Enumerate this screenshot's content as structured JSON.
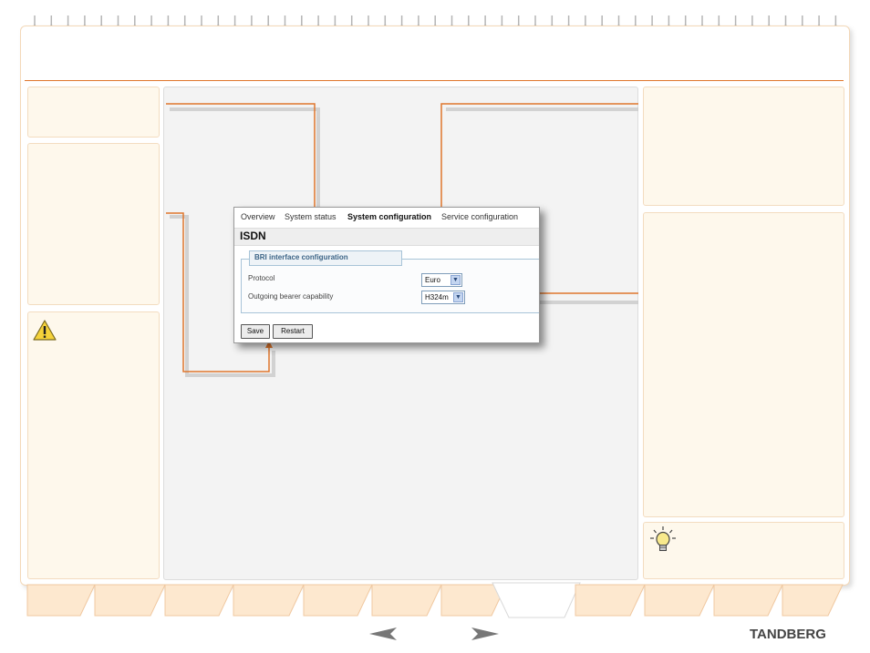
{
  "ui_screenshot": {
    "nav_tabs": [
      {
        "label": "Overview",
        "active": false
      },
      {
        "label": "System status",
        "active": false
      },
      {
        "label": "System configuration",
        "active": true
      },
      {
        "label": "Service configuration",
        "active": false
      }
    ],
    "page_title": "ISDN",
    "section": {
      "legend": "BRI interface configuration",
      "fields": [
        {
          "label": "Protocol",
          "value": "Euro"
        },
        {
          "label": "Outgoing bearer capability",
          "value": "H324m"
        }
      ]
    },
    "buttons": {
      "save": "Save",
      "restart": "Restart"
    }
  },
  "icons": {
    "warning": "warning-icon",
    "tip": "lightbulb-icon",
    "prev": "prev-arrow-icon",
    "next": "next-arrow-icon"
  },
  "colors": {
    "accent": "#e0762c",
    "panel_bg": "#fef8ec",
    "panel_border": "#f3dcc0",
    "center_bg": "#f3f3f3"
  },
  "brand": {
    "logo": "TANDBERG"
  }
}
